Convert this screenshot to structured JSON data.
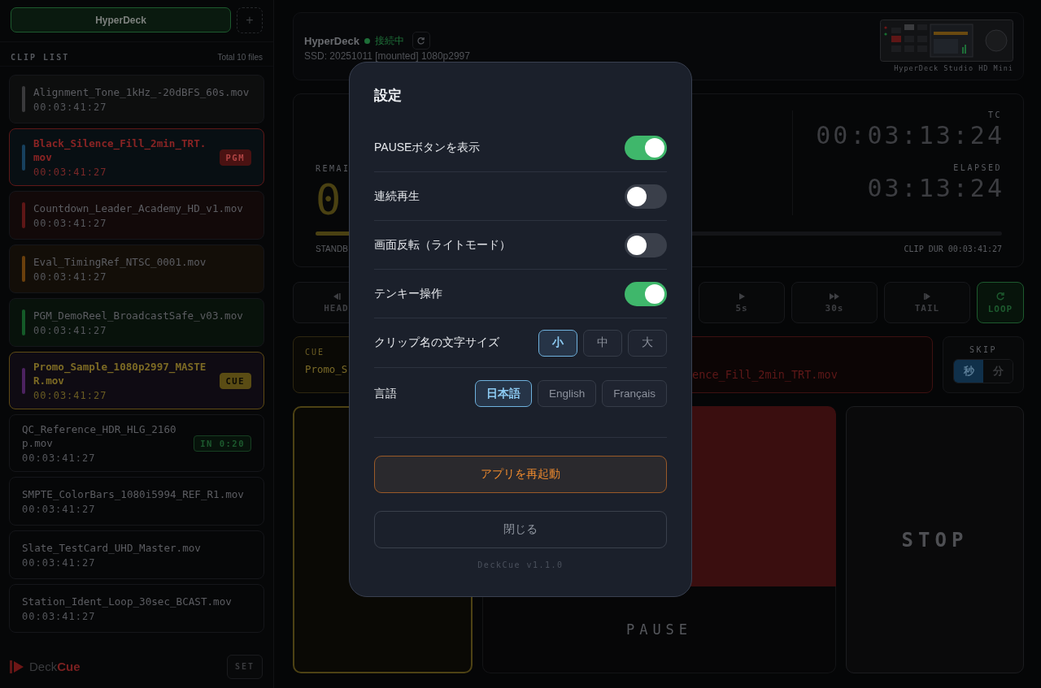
{
  "sidebar": {
    "device_tab": "HyperDeck",
    "add_button": "+",
    "clip_list_title": "CLIP LIST",
    "total": "Total 10 files",
    "clips": [
      {
        "name": "Alignment_Tone_1kHz_-20dBFS_60s.mov",
        "duration": "00:03:41:27",
        "color": "#3a3a3c",
        "kind": "plain"
      },
      {
        "name": "Black_Silence_Fill_2min_TRT.mov",
        "duration": "00:03:41:27",
        "color": "#17405e",
        "kind": "pgm",
        "badge": {
          "text": "PGM",
          "kind": "pgm"
        }
      },
      {
        "name": "Countdown_Leader_Academy_HD_v1.mov",
        "duration": "00:03:41:27",
        "color": "#5e1616",
        "kind": "plain"
      },
      {
        "name": "Eval_TimingRef_NTSC_0001.mov",
        "duration": "00:03:41:27",
        "color": "#6a3f0c",
        "kind": "plain"
      },
      {
        "name": "PGM_DemoReel_BroadcastSafe_v03.mov",
        "duration": "00:03:41:27",
        "color": "#145a28",
        "kind": "plain"
      },
      {
        "name": "Promo_Sample_1080p2997_MASTER.mov",
        "duration": "00:03:41:27",
        "color": "#4c2260",
        "kind": "cue",
        "badge": {
          "text": "CUE",
          "kind": "cue"
        }
      },
      {
        "name": "QC_Reference_HDR_HLG_2160p.mov",
        "duration": "00:03:41:27",
        "kind": "plain",
        "badge": {
          "text": "IN 0:20",
          "kind": "in"
        }
      },
      {
        "name": "SMPTE_ColorBars_1080i5994_REF_R1.mov",
        "duration": "00:03:41:27",
        "kind": "plain"
      },
      {
        "name": "Slate_TestCard_UHD_Master.mov",
        "duration": "00:03:41:27",
        "kind": "plain"
      },
      {
        "name": "Station_Ident_Loop_30sec_BCAST.mov",
        "duration": "00:03:41:27",
        "kind": "plain"
      }
    ],
    "logo": {
      "prefix": "Deck",
      "suffix": "Cue"
    },
    "set_button": "SET"
  },
  "header": {
    "device": "HyperDeck",
    "status": "接続中",
    "connected": true,
    "storage": "SSD: 20251011 [mounted] 1080p2997",
    "model": "HyperDeck Studio HD Mini"
  },
  "timer": {
    "remaining_label": "REMAI",
    "remaining_value": "0",
    "level": 0.3,
    "state": "STANDB",
    "tc_label": "TC",
    "tc": "00:03:13:24",
    "elapsed_label": "ELAPSED",
    "elapsed": "03:13:24",
    "clip_dur": "CLIP DUR 00:03:41:27"
  },
  "transport": [
    {
      "label": "HEAD",
      "kind": "head",
      "on": false
    },
    {
      "label": "5s",
      "kind": "play",
      "on": false
    },
    {
      "label": "30s",
      "kind": "ffwd",
      "on": false
    },
    {
      "label": "TAIL",
      "kind": "tail",
      "on": false
    },
    {
      "label": "LOOP",
      "kind": "loop",
      "on": true
    }
  ],
  "cue": {
    "label": "CUE",
    "clip": "Promo_S"
  },
  "program": {
    "clip": "ence_Fill_2min_TRT.mov"
  },
  "skip": {
    "label": "SKIP",
    "units": [
      {
        "label": "秒",
        "selected": true
      },
      {
        "label": "分",
        "selected": false
      }
    ]
  },
  "pads": {
    "pause": "PAUSE",
    "stop": "STOP"
  },
  "settings": {
    "title": "設定",
    "items": [
      {
        "kind": "toggle",
        "label": "PAUSEボタンを表示",
        "on": true
      },
      {
        "kind": "toggle",
        "label": "連続再生",
        "on": false
      },
      {
        "kind": "toggle",
        "label": "画面反転（ライトモード）",
        "on": false
      },
      {
        "kind": "toggle",
        "label": "テンキー操作",
        "on": true
      },
      {
        "kind": "choice",
        "label": "クリップ名の文字サイズ",
        "options": [
          {
            "label": "小",
            "selected": true
          },
          {
            "label": "中",
            "selected": false
          },
          {
            "label": "大",
            "selected": false
          }
        ]
      },
      {
        "kind": "choice",
        "label": "言語",
        "options": [
          {
            "label": "日本語",
            "selected": true
          },
          {
            "label": "English",
            "selected": false
          },
          {
            "label": "Français",
            "selected": false
          }
        ]
      }
    ],
    "restart": "アプリを再起動",
    "close": "閉じる",
    "version": "DeckCue v1.1.0"
  }
}
